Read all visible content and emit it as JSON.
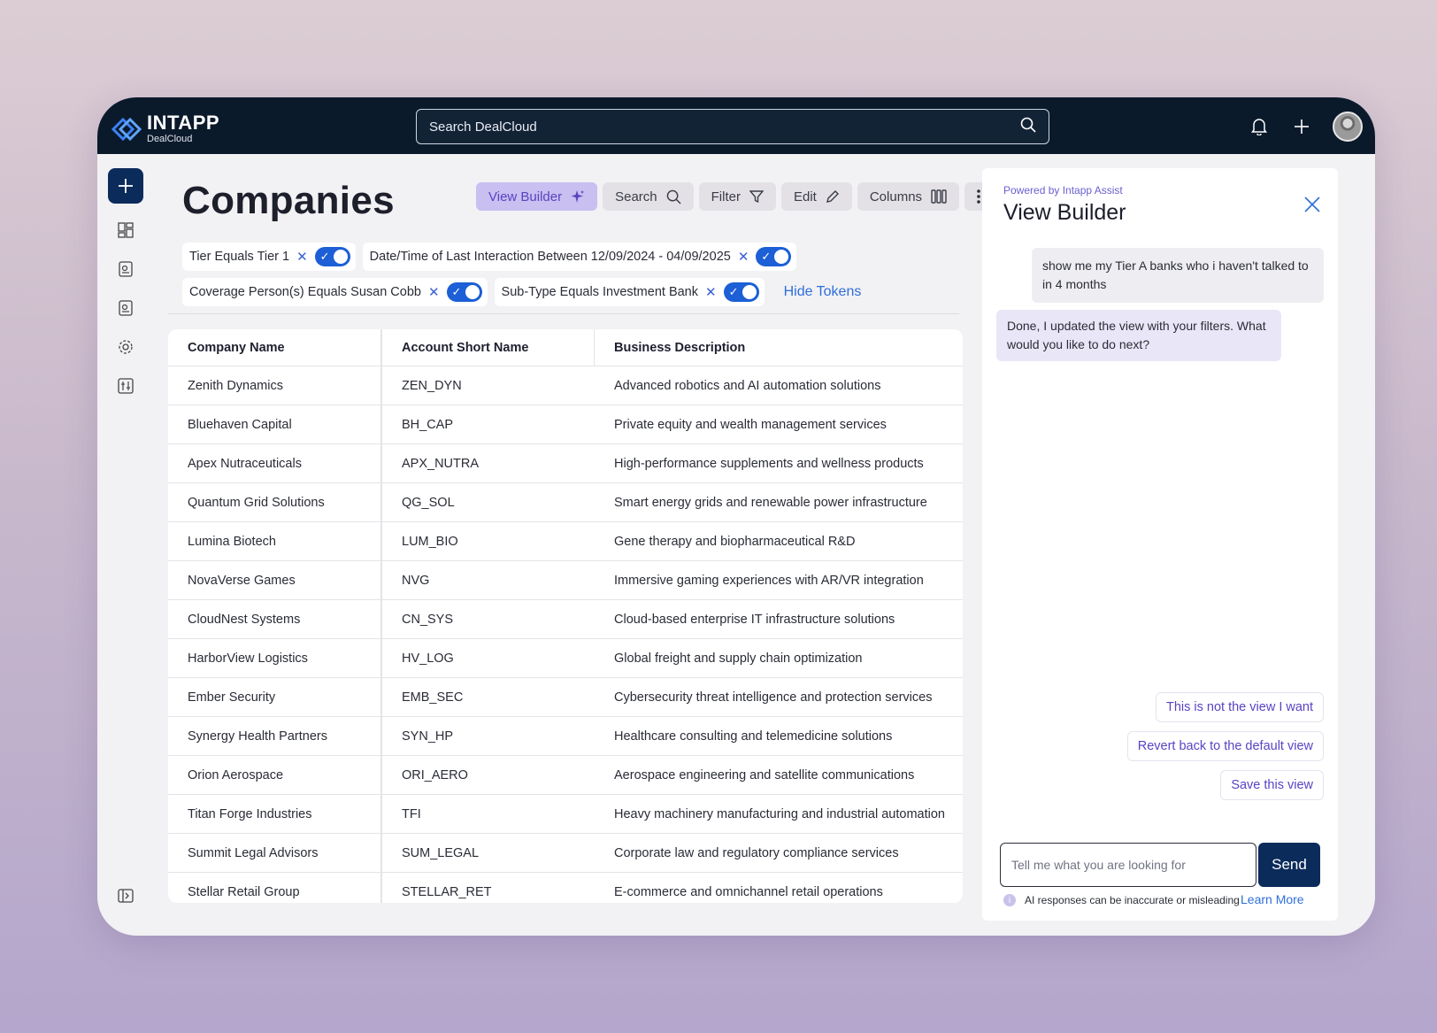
{
  "brand": {
    "name": "INTAPP",
    "product": "DealCloud"
  },
  "search": {
    "placeholder": "Search DealCloud"
  },
  "page": {
    "title": "Companies"
  },
  "toolbar": {
    "view_builder": "View Builder",
    "search": "Search",
    "filter": "Filter",
    "edit": "Edit",
    "columns": "Columns"
  },
  "filters": [
    {
      "label": "Tier Equals Tier 1",
      "enabled": true
    },
    {
      "label": "Date/Time of Last Interaction Between 12/09/2024 - 04/09/2025",
      "enabled": true
    },
    {
      "label": "Coverage Person(s) Equals Susan Cobb",
      "enabled": true
    },
    {
      "label": "Sub-Type Equals Investment Bank",
      "enabled": true
    }
  ],
  "hide_tokens": "Hide Tokens",
  "table": {
    "headers": [
      "Company Name",
      "Account Short Name",
      "Business Description"
    ],
    "rows": [
      [
        "Zenith Dynamics",
        "ZEN_DYN",
        "Advanced robotics and AI automation solutions"
      ],
      [
        "Bluehaven Capital",
        "BH_CAP",
        "Private equity and wealth management services"
      ],
      [
        "Apex Nutraceuticals",
        "APX_NUTRA",
        "High-performance supplements and wellness products"
      ],
      [
        "Quantum Grid Solutions",
        "QG_SOL",
        "Smart energy grids and renewable power infrastructure"
      ],
      [
        "Lumina Biotech",
        "LUM_BIO",
        "Gene therapy and biopharmaceutical R&D"
      ],
      [
        "NovaVerse Games",
        "NVG",
        "Immersive gaming experiences with AR/VR integration"
      ],
      [
        "CloudNest Systems",
        "CN_SYS",
        "Cloud-based enterprise IT infrastructure solutions"
      ],
      [
        "HarborView Logistics",
        "HV_LOG",
        "Global freight and supply chain optimization"
      ],
      [
        "Ember Security",
        "EMB_SEC",
        "Cybersecurity threat intelligence and protection services"
      ],
      [
        "Synergy Health Partners",
        "SYN_HP",
        "Healthcare consulting and telemedicine solutions"
      ],
      [
        "Orion Aerospace",
        "ORI_AERO",
        "Aerospace engineering and satellite communications"
      ],
      [
        "Titan Forge Industries",
        "TFI",
        "Heavy machinery manufacturing and industrial automation"
      ],
      [
        "Summit Legal Advisors",
        "SUM_LEGAL",
        "Corporate law and regulatory compliance services"
      ],
      [
        "Stellar Retail Group",
        "STELLAR_RET",
        "E-commerce and omnichannel retail operations"
      ]
    ]
  },
  "assistant": {
    "powered_prefix": "Powered by ",
    "powered_brand": "Intapp Assist",
    "title": "View Builder",
    "user_message": "show me my Tier A banks who i haven't talked to in 4 months",
    "ai_message": "Done, I updated the view with your filters. What would you like to do next?",
    "suggestions": [
      "This is not the view I want",
      "Revert back to the default view",
      "Save this view"
    ],
    "input_placeholder": "Tell me what you are looking for",
    "send": "Send",
    "disclaimer": "AI responses can be inaccurate or misleading",
    "learn_more": "Learn More"
  },
  "colors": {
    "nav_bg": "#0b1a2b",
    "primary": "#0b2b5b",
    "accent_purple": "#5a43c3",
    "toggle_blue": "#1c5fd6",
    "link_blue": "#2e6fd9"
  }
}
